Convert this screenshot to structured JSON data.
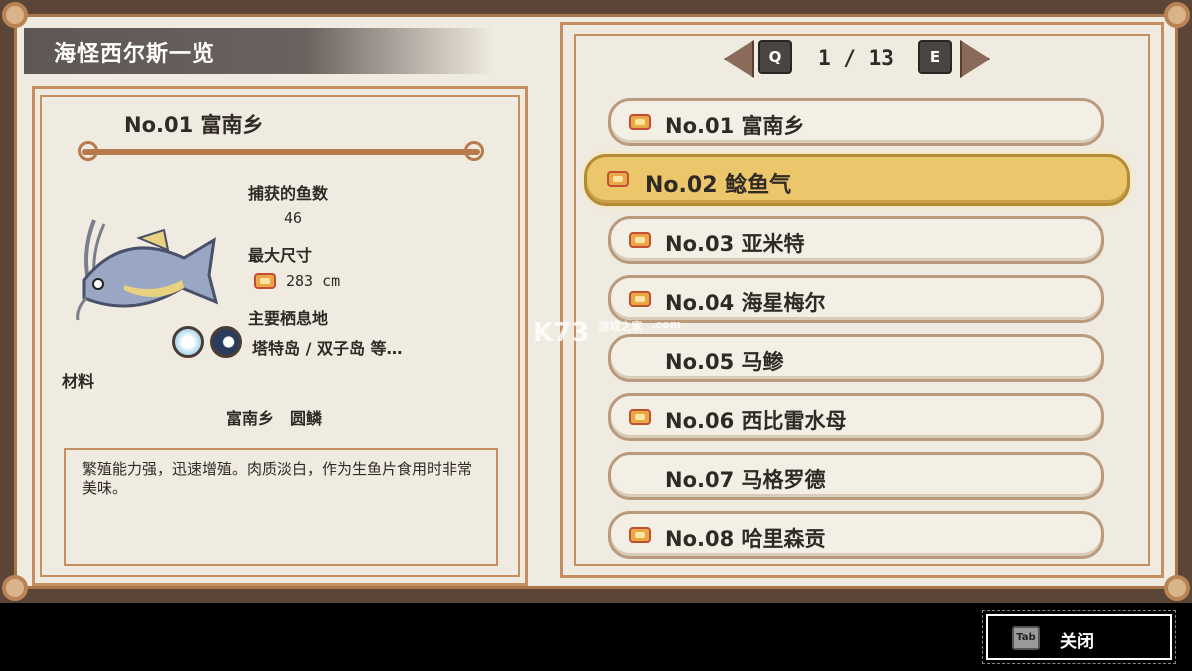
{
  "header": {
    "title": "海怪西尔斯一览"
  },
  "detail": {
    "name": "No.01 富南乡",
    "caught_label": "捕获的鱼数",
    "caught_value": "46",
    "max_size_label": "最大尺寸",
    "max_size_value": "283 cm",
    "habitat_label": "主要栖息地",
    "habitat_value": "塔特岛 / 双子岛 等…",
    "category": "材料",
    "tags": "富南乡　圆鳞",
    "description": "繁殖能力强，迅速增殖。肉质淡白，作为生鱼片食用时非常美味。"
  },
  "pager": {
    "prev_key": "Q",
    "next_key": "E",
    "page": "1 / 13"
  },
  "list": [
    {
      "label": "No.01 富南乡",
      "crown": true,
      "selected": false
    },
    {
      "label": "No.02 鲶鱼气",
      "crown": true,
      "selected": true
    },
    {
      "label": "No.03 亚米特",
      "crown": true,
      "selected": false
    },
    {
      "label": "No.04 海星梅尔",
      "crown": true,
      "selected": false
    },
    {
      "label": "No.05 马鲹",
      "crown": false,
      "selected": false
    },
    {
      "label": "No.06 西比雷水母",
      "crown": true,
      "selected": false
    },
    {
      "label": "No.07 马格罗德",
      "crown": false,
      "selected": false
    },
    {
      "label": "No.08 哈里森贡",
      "crown": true,
      "selected": false
    }
  ],
  "footer": {
    "key": "Tab",
    "close_label": "关闭"
  },
  "watermark": {
    "text": "K73",
    "sub": "游戏之家",
    "domain": ".com"
  },
  "colors": {
    "selected_row": "#ecc66b",
    "border": "#c58f61",
    "frame": "#5b4536"
  }
}
